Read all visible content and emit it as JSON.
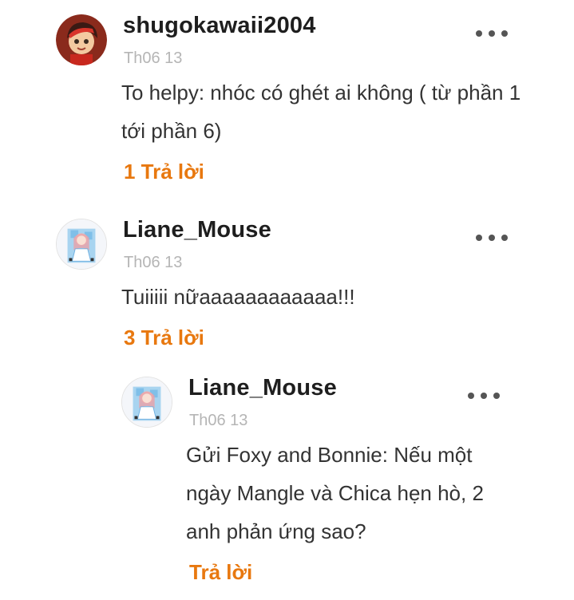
{
  "comments": [
    {
      "username": "shugokawaii2004",
      "date": "Th06 13",
      "text": "To helpy: nhóc có ghét ai không ( từ phần 1 tới phần 6)",
      "reply_label": "1 Trả lời",
      "avatar_icon": "boy-avatar-icon"
    },
    {
      "username": "Liane_Mouse",
      "date": "Th06 13",
      "text": "Tuiiiii nữaaaaaaaaaaaa!!!",
      "reply_label": "3 Trả lời",
      "avatar_icon": "anime-girl-avatar-icon"
    }
  ],
  "replies": [
    {
      "username": "Liane_Mouse",
      "date": "Th06 13",
      "text": "Gửi Foxy and Bonnie: Nếu một ngày Mangle và Chica hẹn hò, 2 anh phản ứng sao?",
      "reply_label": "Trả lời",
      "avatar_icon": "anime-girl-avatar-icon"
    }
  ],
  "colors": {
    "accent": "#e8780f",
    "username": "#1e1e1e",
    "date": "#b5b5b5",
    "text": "#333333"
  }
}
